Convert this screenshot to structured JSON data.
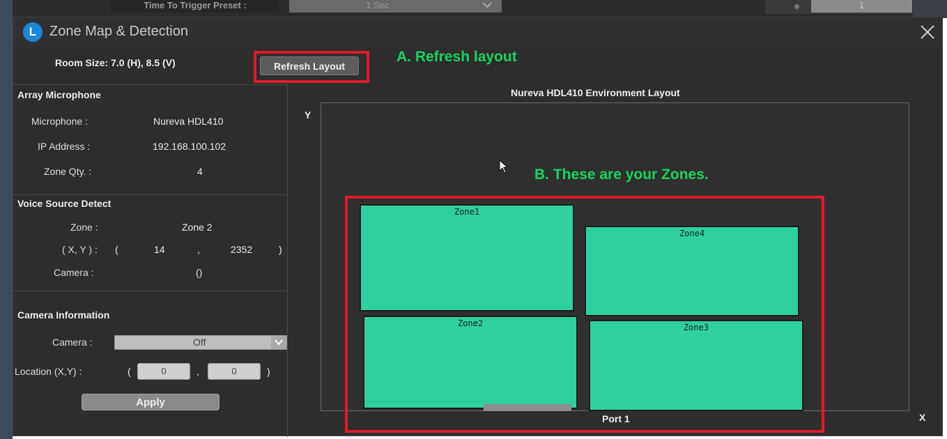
{
  "background": {
    "preset_label": "Time To Trigger Preset :",
    "preset_value": "1 Sec",
    "right_value": "1"
  },
  "dialog": {
    "title": "Zone Map & Detection",
    "room_size": "Room Size:  7.0 (H), 8.5 (V)",
    "refresh_label": "Refresh Layout"
  },
  "array_microphone": {
    "title": "Array Microphone",
    "microphone_label": "Microphone :",
    "microphone_value": "Nureva HDL410",
    "ip_label": "IP Address :",
    "ip_value": "192.168.100.102",
    "zone_qty_label": "Zone Qty. :",
    "zone_qty_value": "4"
  },
  "voice_source": {
    "title": "Voice Source Detect",
    "zone_label": "Zone :",
    "zone_value": "Zone 2",
    "xy_label": "( X, Y ) :",
    "open_paren": "(",
    "x_value": "14",
    "comma": ",",
    "y_value": "2352",
    "close_paren": ")",
    "camera_label": "Camera :",
    "camera_value": "()"
  },
  "camera_info": {
    "title": "Camera Information",
    "camera_label": "Camera :",
    "camera_selected": "Off",
    "location_label": "Location (X,Y) :",
    "open_paren": "(",
    "loc_x": "0",
    "comma": ",",
    "loc_y": "0",
    "close_paren": ")",
    "apply_label": "Apply"
  },
  "layout": {
    "title": "Nureva HDL410 Environment Layout",
    "y_axis": "Y",
    "x_axis": "X",
    "port": "Port 1",
    "zones": [
      "Zone1",
      "Zone4",
      "Zone2",
      "Zone3"
    ],
    "zone_color": "#2fd0a0"
  },
  "annotations": {
    "a": "A. Refresh layout",
    "b": "B. These are your Zones.",
    "highlight_color": "#e0192a",
    "text_color": "#17d45f"
  }
}
